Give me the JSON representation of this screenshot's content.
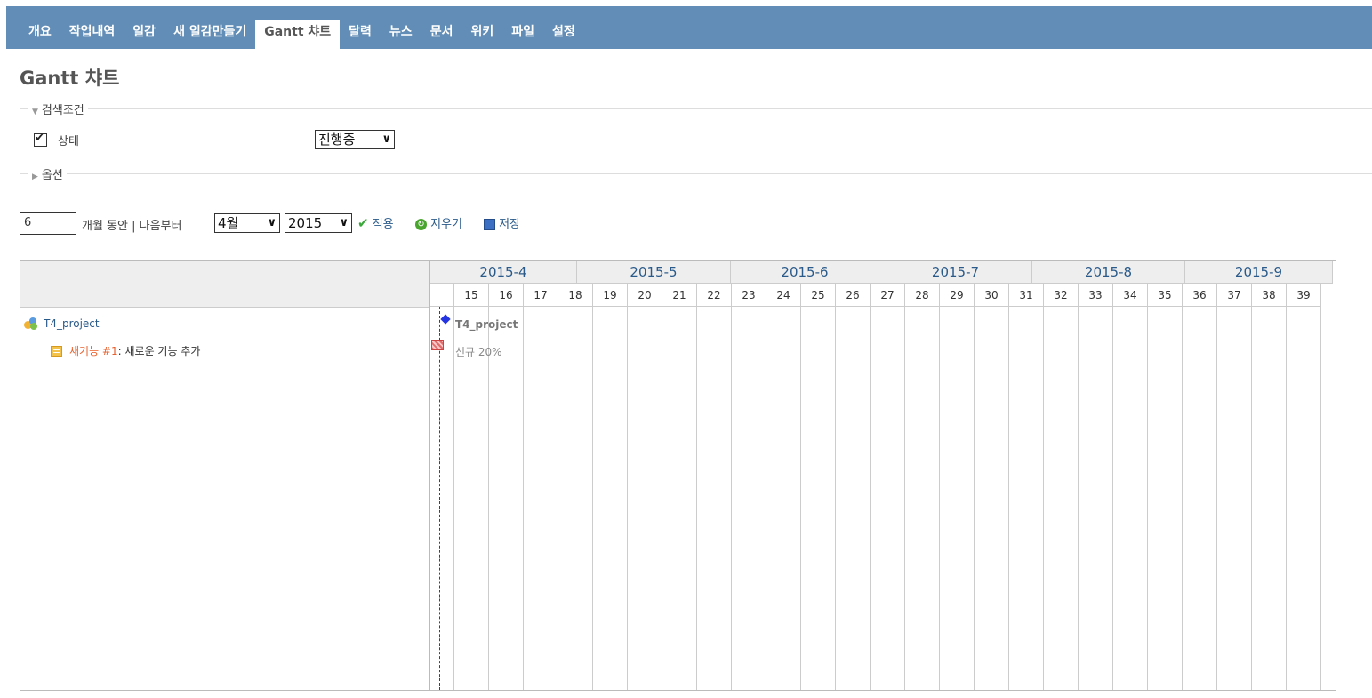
{
  "nav": {
    "tabs": [
      {
        "label": "개요"
      },
      {
        "label": "작업내역"
      },
      {
        "label": "일감"
      },
      {
        "label": "새 일감만들기"
      },
      {
        "label": "Gantt 챠트"
      },
      {
        "label": "달력"
      },
      {
        "label": "뉴스"
      },
      {
        "label": "문서"
      },
      {
        "label": "위키"
      },
      {
        "label": "파일"
      },
      {
        "label": "설정"
      }
    ],
    "selected_index": 4
  },
  "page_title": "Gantt 챠트",
  "filters": {
    "legend": "검색조건",
    "status_label": "상태",
    "status_checked": true,
    "status_value": "진행중"
  },
  "options": {
    "legend": "옵션"
  },
  "controls": {
    "months_value": "6",
    "months_text": "개월 동안 | 다음부터",
    "month_select": "4월",
    "year_select": "2015",
    "apply_label": "적용",
    "clear_label": "지우기",
    "save_label": "저장"
  },
  "gantt": {
    "months": [
      "2015-4",
      "2015-5",
      "2015-6",
      "2015-7",
      "2015-8",
      "2015-9"
    ],
    "weeks": [
      "15",
      "16",
      "17",
      "18",
      "19",
      "20",
      "21",
      "22",
      "23",
      "24",
      "25",
      "26",
      "27",
      "28",
      "29",
      "30",
      "31",
      "32",
      "33",
      "34",
      "35",
      "36",
      "37",
      "38",
      "39"
    ],
    "project": {
      "name": "T4_project",
      "bar_label": "T4_project"
    },
    "issue": {
      "tracker": "새기능 #1",
      "subject": "새로운 기능 추가",
      "bar_label": "신규 20%"
    }
  },
  "colors": {
    "nav_bg": "#628db6",
    "link": "#2a5a8a",
    "issue_link": "#e8602c",
    "milestone": "#2334e0"
  }
}
